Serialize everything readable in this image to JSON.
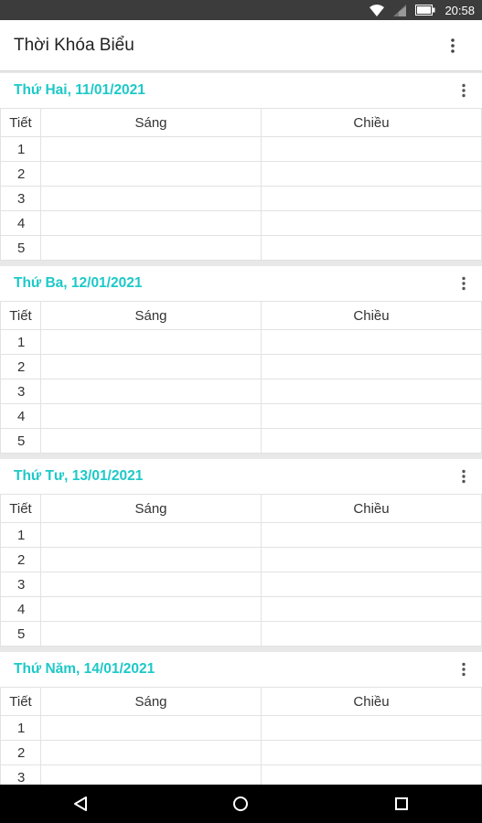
{
  "status_bar": {
    "time": "20:58"
  },
  "app_bar": {
    "title": "Thời Khóa Biểu"
  },
  "table_headers": {
    "period": "Tiết",
    "morning": "Sáng",
    "afternoon": "Chiều"
  },
  "days": [
    {
      "title": "Thứ Hai, 11/01/2021",
      "periods": [
        "1",
        "2",
        "3",
        "4",
        "5"
      ]
    },
    {
      "title": "Thứ Ba, 12/01/2021",
      "periods": [
        "1",
        "2",
        "3",
        "4",
        "5"
      ]
    },
    {
      "title": "Thứ Tư, 13/01/2021",
      "periods": [
        "1",
        "2",
        "3",
        "4",
        "5"
      ]
    },
    {
      "title": "Thứ Năm, 14/01/2021",
      "periods": [
        "1",
        "2",
        "3"
      ]
    }
  ],
  "icons": {
    "status": [
      "wifi-icon",
      "cell-signal-icon",
      "battery-icon"
    ],
    "navigation": [
      "back-icon",
      "home-icon",
      "recents-icon"
    ],
    "menu": "more-vert-icon"
  },
  "colors": {
    "accent": "#1ec8c8",
    "status_bar": "#3c3c3c",
    "nav_bar": "#000000"
  }
}
